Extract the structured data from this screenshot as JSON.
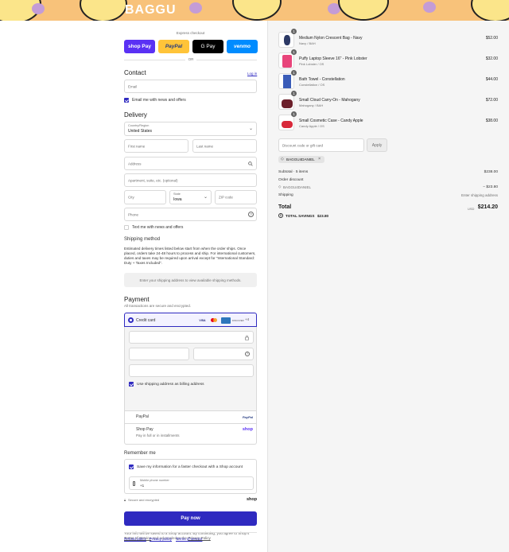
{
  "brand": {
    "name": "BAGGU"
  },
  "express": {
    "label": "Express checkout",
    "buttons": {
      "shop": "shop Pay",
      "paypal": "PayPal",
      "gpay": "G Pay",
      "venmo": "venmo"
    },
    "or": "OR"
  },
  "contact": {
    "title": "Contact",
    "login": "Log in",
    "email_placeholder": "Email",
    "news_label": "Email me with news and offers"
  },
  "delivery": {
    "title": "Delivery",
    "country_label": "Country/Region",
    "country_value": "United States",
    "first_name": "First name",
    "last_name": "Last name",
    "address": "Address",
    "apartment": "Apartment, suite, etc. (optional)",
    "city": "City",
    "state_label": "State",
    "state_value": "Iowa",
    "zip": "ZIP code",
    "phone": "Phone",
    "text_label": "Text me with news and offers"
  },
  "shipping": {
    "title": "Shipping method",
    "note": "Estimated delivery times listed below start from when the order ships. Once placed, orders take 24-48 hours to process and ship. For international customers, duties and taxes may be required upon arrival except for \"International Standard: Duty + Taxes Included\".",
    "placeholder": "Enter your shipping address to view available shipping methods."
  },
  "payment": {
    "title": "Payment",
    "subtitle": "All transactions are secure and encrypted.",
    "credit_card": "Credit card",
    "more_cards": "+4",
    "card_logos": [
      "VISA",
      "MC",
      "AMEX",
      "DISCOVER"
    ],
    "billing_label": "Use shipping address as billing address",
    "paypal": "PayPal",
    "paypal_logo": "PayPal",
    "shop_pay": "Shop Pay",
    "shop_pay_sub": "Pay in full or in installments",
    "shop_logo": "shop"
  },
  "remember": {
    "title": "Remember me",
    "save_label": "Save my information for a faster checkout with a Shop account",
    "mobile_label": "Mobile phone number",
    "mobile_value": "+1",
    "secure": "Secure and encrypted",
    "shop_logo": "shop"
  },
  "pay_now": "Pay now",
  "legal": {
    "prefix": "Your info will be saved to a Shop account. By continuing, you agree to Shop's",
    "terms": "Terms of Service",
    "middle": "and acknowledge the",
    "privacy": "Privacy Policy"
  },
  "footer": {
    "refund": "Refund policy",
    "privacy": "Privacy policy",
    "terms": "Terms of service"
  },
  "cart": {
    "items": [
      {
        "name": "Medium Nylon Crescent Bag - Navy",
        "variant": "Navy / BAH",
        "price": "$52.00",
        "qty": "1",
        "color": "#2d3a66"
      },
      {
        "name": "Puffy Laptop Sleeve 16\" - Pink Lobster",
        "variant": "Pink Lobster / OS",
        "price": "$32.00",
        "qty": "1",
        "color": "#e8447a"
      },
      {
        "name": "Bath Towel - Constellation",
        "variant": "Constellation / OS",
        "price": "$44.00",
        "qty": "1",
        "color": "#3a5cb8"
      },
      {
        "name": "Small Cloud Carry-On - Mahogany",
        "variant": "Mahogany / BAH",
        "price": "$72.00",
        "qty": "1",
        "color": "#6b1f2a"
      },
      {
        "name": "Small Cosmetic Case - Candy Apple",
        "variant": "Candy Apple / OS",
        "price": "$38.00",
        "qty": "1",
        "color": "#d8283a"
      }
    ],
    "discount_placeholder": "Discount code or gift card",
    "apply": "Apply",
    "code_tag": "BAGGU4DANIEL",
    "subtotal_label": "Subtotal · 5 items",
    "subtotal_value": "$238.00",
    "order_discount_label": "Order discount",
    "discount_code": "BAGGU4DANIEL",
    "discount_value": "− $23.80",
    "shipping_label": "Shipping",
    "shipping_value": "Enter shipping address",
    "total_label": "Total",
    "currency": "USD",
    "total_value": "$214.20",
    "savings_label": "TOTAL SAVINGS",
    "savings_value": "$23.80"
  },
  "colors": {
    "accent": "#2f2ac0",
    "shop": "#5a31f4",
    "paypal": "#ffc439",
    "venmo": "#008cff"
  }
}
